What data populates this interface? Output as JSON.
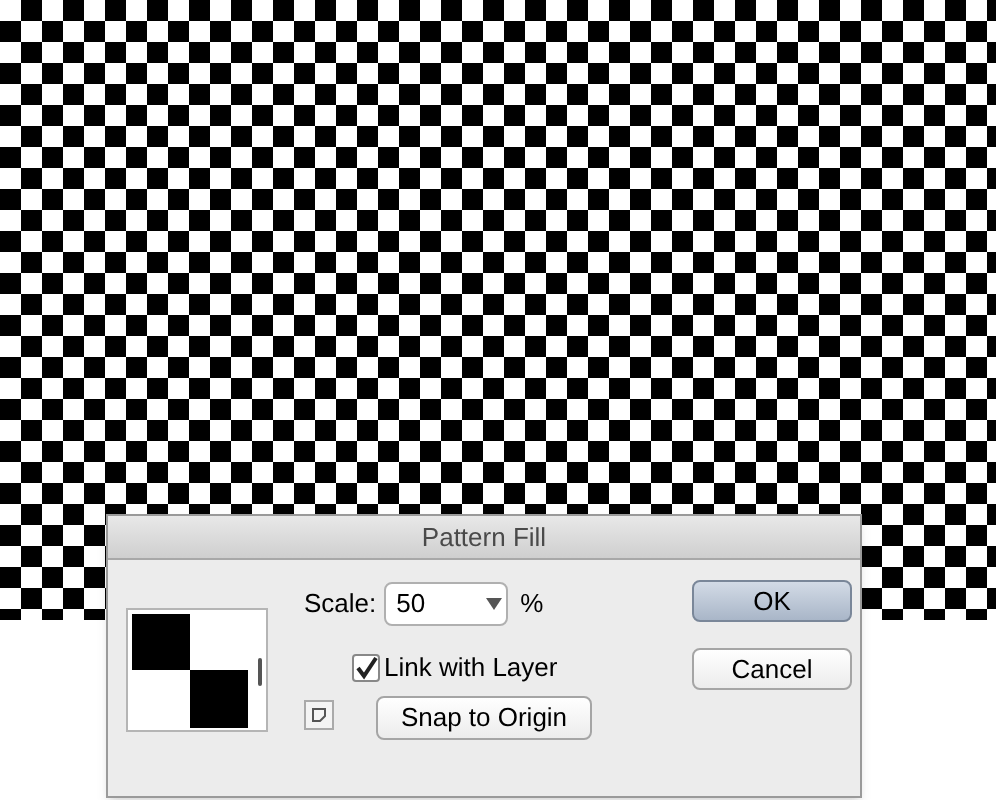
{
  "dialog": {
    "title": "Pattern Fill",
    "scale": {
      "label": "Scale:",
      "value": "50",
      "unit": "%"
    },
    "link_with_layer": {
      "label": "Link with Layer",
      "checked": true
    },
    "snap_button": "Snap to Origin",
    "buttons": [
      {
        "label": "OK",
        "default": true
      },
      {
        "label": "Cancel",
        "default": false
      }
    ]
  }
}
